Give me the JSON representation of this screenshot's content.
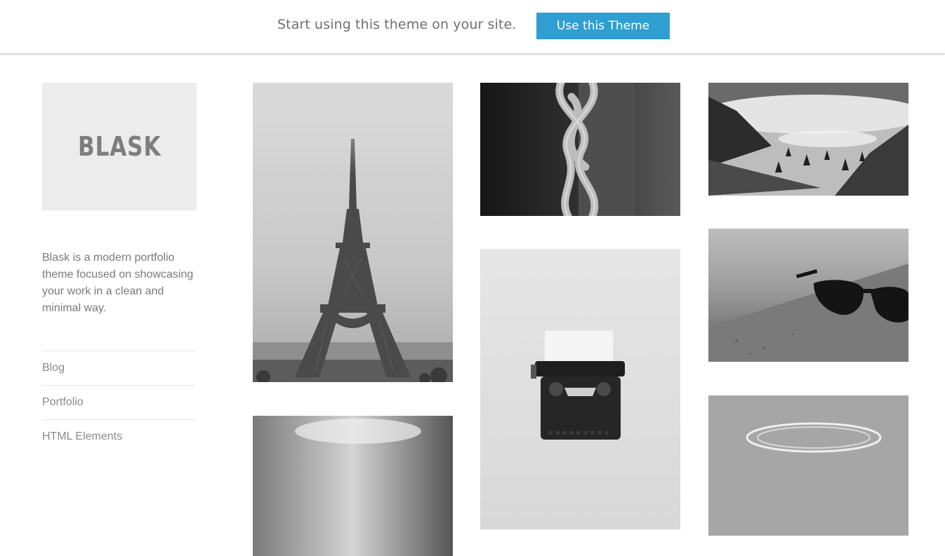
{
  "topbar": {
    "message": "Start using this theme on your site.",
    "cta_label": "Use this Theme",
    "cta_color": "#2f9fd1"
  },
  "site": {
    "logo": "BLASK",
    "description": "Blask is a modern portfolio theme focused on showcasing your work in a clean and minimal way."
  },
  "nav": {
    "items": [
      {
        "label": "Blog"
      },
      {
        "label": "Portfolio"
      },
      {
        "label": "HTML Elements"
      }
    ]
  },
  "gallery": {
    "items": [
      {
        "subject": "eiffel-tower"
      },
      {
        "subject": "knotted-rope"
      },
      {
        "subject": "foggy-forest-hills"
      },
      {
        "subject": "typewriter"
      },
      {
        "subject": "sunglasses"
      },
      {
        "subject": "cloudy-sky"
      },
      {
        "subject": "wire-basket"
      }
    ]
  }
}
